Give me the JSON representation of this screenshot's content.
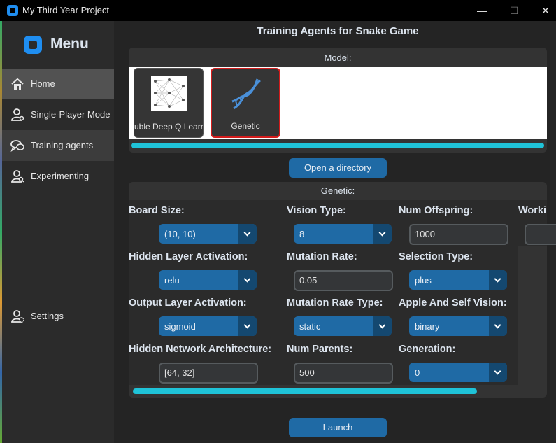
{
  "window": {
    "title": "My Third Year Project",
    "minimize": "—",
    "maximize": "☐",
    "close": "✕"
  },
  "sidebar": {
    "title": "Menu",
    "items": [
      {
        "label": "Home",
        "icon": "home-icon"
      },
      {
        "label": "Single-Player Mode",
        "icon": "user-icon"
      },
      {
        "label": "Training agents",
        "icon": "chat-icon"
      },
      {
        "label": "Experimenting",
        "icon": "user-search-icon"
      }
    ],
    "settings": {
      "label": "Settings",
      "icon": "user-gear-icon"
    }
  },
  "main": {
    "title": "Training Agents for Snake Game",
    "model_section": {
      "label": "Model:",
      "cards": [
        {
          "label": "uble Deep Q Learr",
          "icon": "neural-network-icon",
          "selected": false
        },
        {
          "label": "Genetic",
          "icon": "dna-icon",
          "selected": true
        }
      ]
    },
    "open_directory_button": "Open a directory",
    "params_section": {
      "label": "Genetic:",
      "board_size": {
        "label": "Board Size:",
        "value": "(10, 10)"
      },
      "vision_type": {
        "label": "Vision Type:",
        "value": "8"
      },
      "num_offspring": {
        "label": "Num Offspring:",
        "value": "1000"
      },
      "working": {
        "label": "Worki"
      },
      "hidden_activation": {
        "label": "Hidden Layer Activation:",
        "value": "relu"
      },
      "mutation_rate": {
        "label": "Mutation Rate:",
        "value": "0.05"
      },
      "selection_type": {
        "label": "Selection Type:",
        "value": "plus"
      },
      "output_activation": {
        "label": "Output Layer Activation:",
        "value": "sigmoid"
      },
      "mutation_rate_type": {
        "label": "Mutation Rate Type:",
        "value": "static"
      },
      "apple_self_vision": {
        "label": "Apple And Self Vision:",
        "value": "binary"
      },
      "hidden_architecture": {
        "label": "Hidden Network Architecture:",
        "value": "[64, 32]"
      },
      "num_parents": {
        "label": "Num Parents:",
        "value": "500"
      },
      "generation": {
        "label": "Generation:",
        "value": "0"
      }
    },
    "launch_button": "Launch"
  },
  "colors": {
    "accent": "#1f6aa5",
    "accent_dark": "#144870",
    "progress": "#1fc3d8",
    "selected_border": "#d21b1b"
  }
}
